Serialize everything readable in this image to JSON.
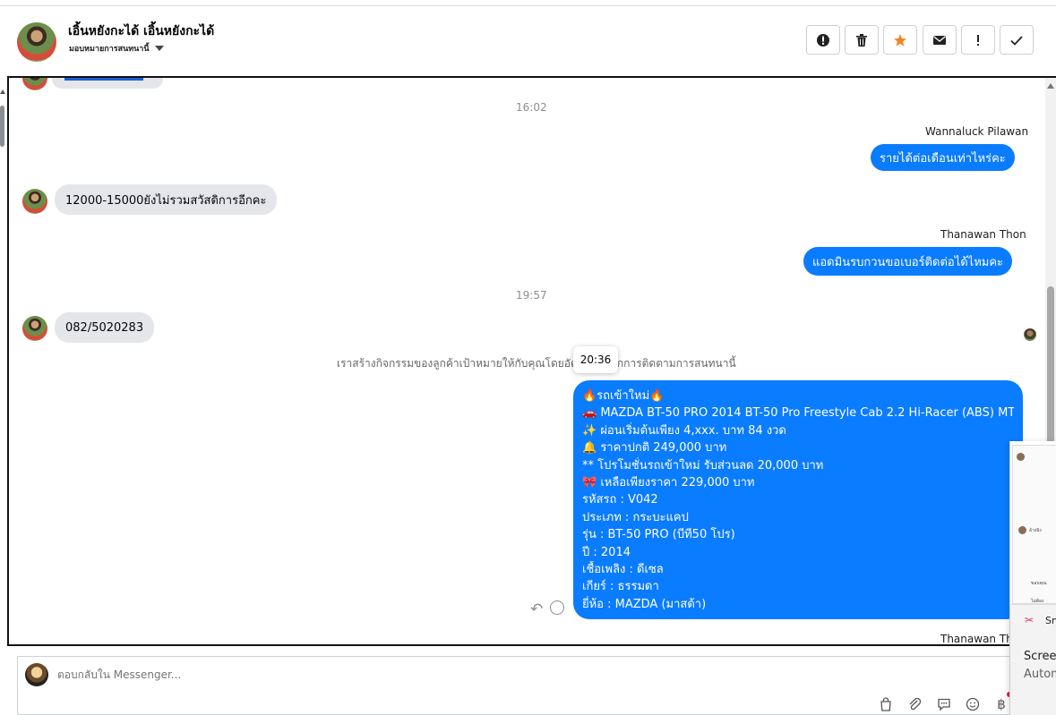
{
  "header": {
    "contact_name": "เอิ้นหยังกะได้ เอิ้นหยังกะได้",
    "assign_label": "มอบหมายการสนทนานี้",
    "actions": [
      {
        "name": "spam-button",
        "icon": "alert-circle-icon"
      },
      {
        "name": "delete-button",
        "icon": "trash-icon"
      },
      {
        "name": "star-button",
        "icon": "star-icon",
        "color": "#f5821f"
      },
      {
        "name": "mark-unread-button",
        "icon": "envelope-icon"
      },
      {
        "name": "follow-up-button",
        "icon": "exclamation-icon"
      },
      {
        "name": "mark-done-button",
        "icon": "check-icon"
      }
    ]
  },
  "messages": {
    "time_1": "16:02",
    "sender_1": "Wannaluck Pilawan",
    "out_1": "รายได้ต่อเดือนเท่าไหร่คะ",
    "in_1": "12000-15000ยังไม่รวมสวัสดิการอีกคะ",
    "sender_2": "Thanawan Thon",
    "out_2": "แอดมินรบกวนขอเบอร์ติดต่อได้ไหมคะ",
    "time_2": "19:57",
    "in_2": "082/5020283",
    "system_note": "เราสร้างกิจกรรมของลูกค้าเป้าหมายให้กับคุณโดยอัตโนมัติจากการติดตามการสนทนานี้",
    "tooltip_time": "20:36",
    "promo_lines": [
      "🔥รถเข้าใหม่🔥",
      "🚗  MAZDA BT-50 PRO 2014 BT-50 Pro Freestyle Cab 2.2 Hi-Racer (ABS) MT",
      "✨  ผ่อนเริ่มต้นเพียง 4,xxx. บาท 84 งวด",
      "🔔   ราคาปกติ 249,000 บาท",
      "** โปรโมชั่นรถเข้าใหม่ รับส่วนลด 20,000 บาท",
      "🎀  เหลือเพียงราคา 229,000 บาท",
      "   รหัสรถ : V042",
      "   ประเภท : กระบะแคป",
      "   รุ่น : BT-50 PRO (บีที50 โปร)",
      "   ปี : 2014",
      "   เชื้อเพลิง : ดีเซล",
      "   เกียร์ : ธรรมดา",
      "   ยี่ห้อ : MAZDA (มาสด้า)"
    ],
    "sender_3": "Thanawan Tho"
  },
  "composer": {
    "placeholder": "ตอบกลับใน Messenger..."
  },
  "snip_overlay": {
    "title": "Sn",
    "line1": "Screer",
    "line2": "Autom",
    "mini_lines": [
      "อ้างอิง",
      "ขอบคุณ",
      "ไม่ต้อง"
    ]
  },
  "colors": {
    "accent_blue": "#0a7cff",
    "incoming_gray": "#e4e6eb",
    "star_orange": "#f5821f"
  }
}
